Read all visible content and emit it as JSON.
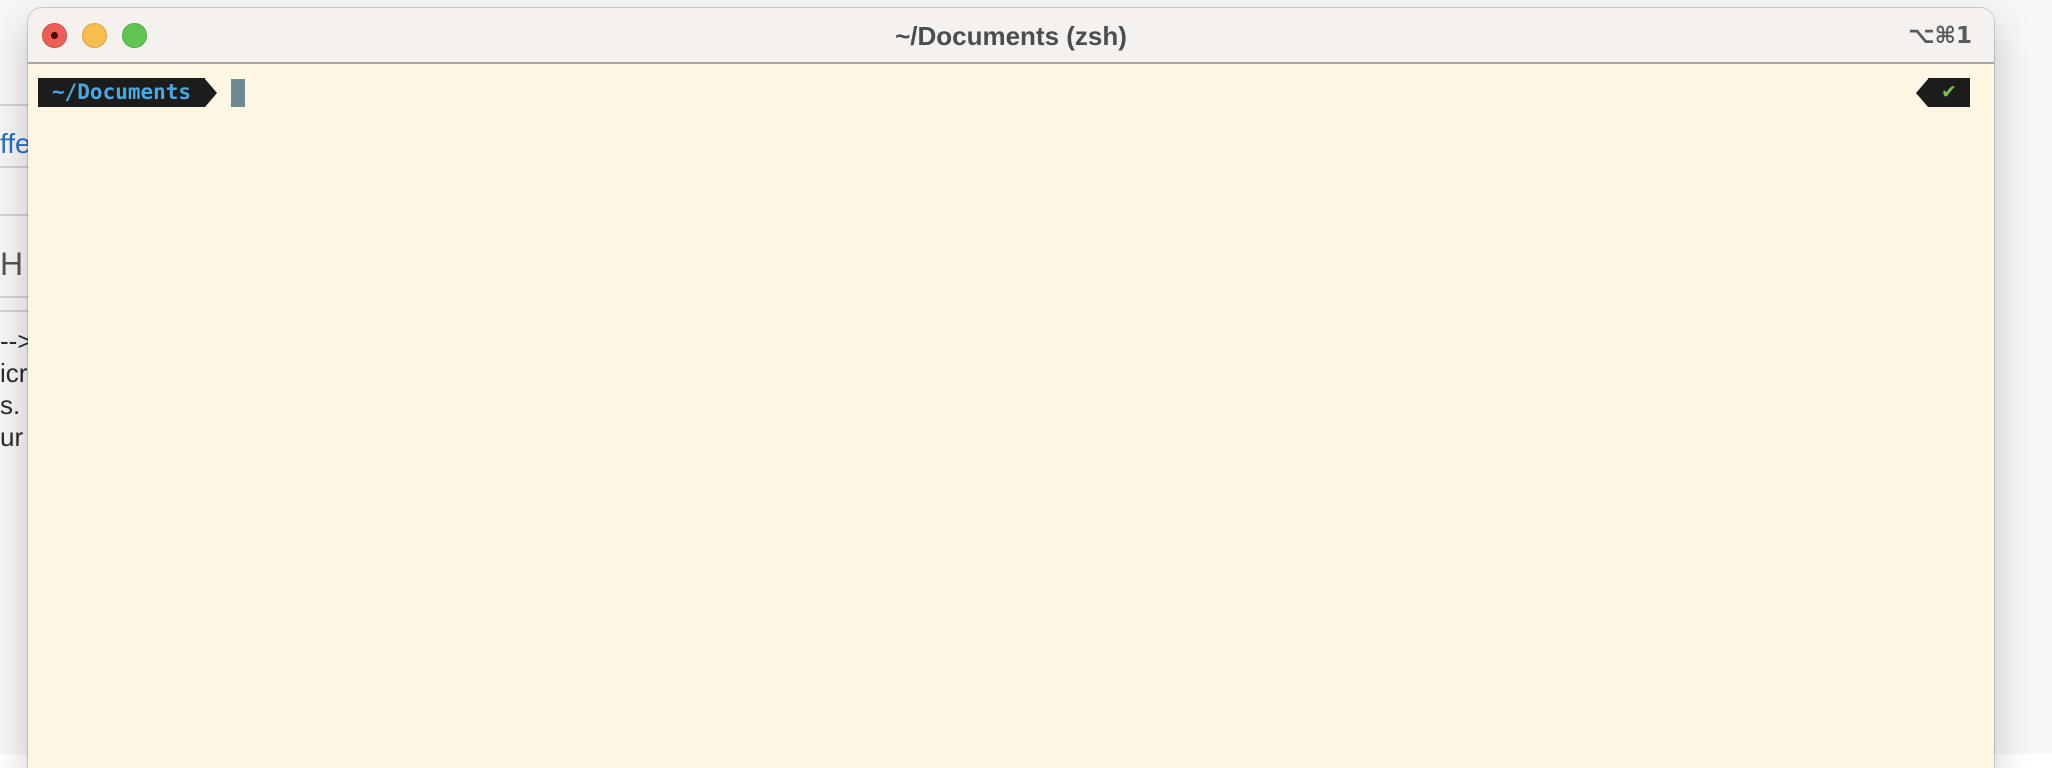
{
  "window": {
    "title": "~/Documents (zsh)",
    "shortcut": "⌥⌘1"
  },
  "prompt": {
    "path": "~/Documents",
    "status_symbol": "✔"
  },
  "background_page": {
    "fragments": [
      "ffe",
      "H",
      "-->",
      "icr",
      "s.",
      "ur"
    ]
  },
  "colors": {
    "terminal_background": "#fdf6e3",
    "prompt_background": "#1c1c1c",
    "prompt_path": "#4aa8e0",
    "status_ok": "#7cc04a",
    "cursor": "#6e8a94",
    "traffic_close": "#ec5f57",
    "traffic_minimize": "#f5be4f",
    "traffic_zoom": "#61c554"
  }
}
